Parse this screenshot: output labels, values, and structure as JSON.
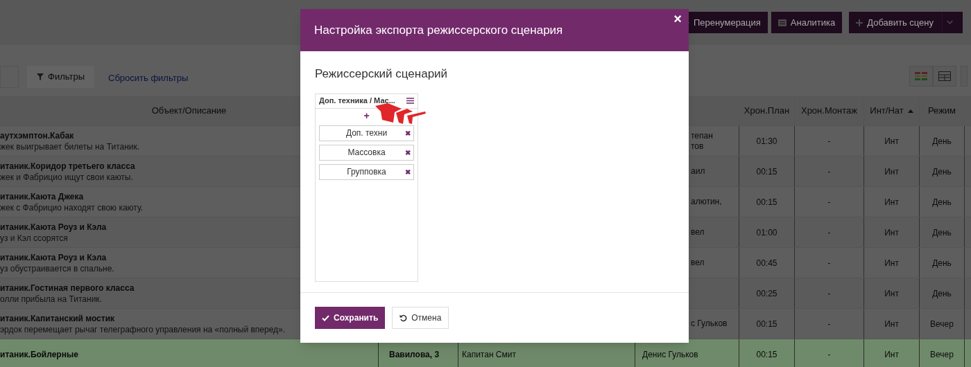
{
  "toolbar": {
    "buttons": [
      {
        "label": "Перенумерация",
        "kind": "renumber"
      },
      {
        "label": "Аналитика",
        "kind": "analytics"
      },
      {
        "label": "Добавить сцену",
        "kind": "add"
      }
    ]
  },
  "filters": {
    "button": "Фильтры",
    "reset_link": "Сбросить фильтры"
  },
  "table": {
    "columns": [
      {
        "label": "Объект/Описание",
        "sorted": false
      },
      {
        "label": "Хрон.План",
        "sorted": false
      },
      {
        "label": "Хрон.Монтаж",
        "sorted": false
      },
      {
        "label": "Инт/Нат",
        "sorted": true
      },
      {
        "label": "Режим",
        "sorted": false
      }
    ],
    "rows": [
      {
        "title": "аутхэмптон.Кабак",
        "description": "жек выигрывает билеты на Титаник.",
        "column_4": [
          "тепан",
          "тов"
        ],
        "plan": "01:30",
        "montage": "-",
        "int_nat": "Инт",
        "mode": "День",
        "highlighted": false
      },
      {
        "title": "итаник.Коридор третьего класса",
        "description": "жек и Фабрицио ищут свои каюты.",
        "column_4": [
          "аил"
        ],
        "plan": "00:15",
        "montage": "-",
        "int_nat": "Инт",
        "mode": "День",
        "highlighted": false
      },
      {
        "title": "итаник.Каюта Джека",
        "description": "жек с Фабрицио находят свою каюту.",
        "column_4": [
          "алютин,"
        ],
        "plan": "00:15",
        "montage": "-",
        "int_nat": "Инт",
        "mode": "День",
        "highlighted": false
      },
      {
        "title": "итаник.Каюта Роуз и Кэла",
        "description": "уз и Кэл ссорятся",
        "column_4": [
          "вел"
        ],
        "plan": "01:00",
        "montage": "-",
        "int_nat": "Инт",
        "mode": "День",
        "highlighted": false
      },
      {
        "title": "итаник.Каюта Роуз и Кэла",
        "description": "уз обустраивается в спальне.",
        "column_4": [
          "вел"
        ],
        "plan": "00:45",
        "montage": "-",
        "int_nat": "Инт",
        "mode": "День",
        "highlighted": false
      },
      {
        "title": "итаник.Гостиная первого класса",
        "description": "олли прибыла на Титаник.",
        "plan": "00:25",
        "montage": "-",
        "int_nat": "Инт",
        "mode": "День",
        "highlighted": false
      },
      {
        "title": "итаник.Капитанский мостик",
        "description": "эрдок перемещает рычаг телеграфного управления на «полный вперед».",
        "column_4": [
          "с Гульков"
        ],
        "plan": "00:15",
        "montage": "-",
        "int_nat": "Инт",
        "mode": "Вечер",
        "highlighted": false
      },
      {
        "title": "итаник.Бойлерные",
        "location": "Вавилова, 3",
        "character": "Капитан Смит",
        "crew": "Денис Гульков",
        "plan": "00:15",
        "montage": "-",
        "int_nat": "Инт",
        "mode": "Вечер",
        "highlighted": true
      }
    ]
  },
  "dialog": {
    "title": "Настройка экспорта режиссерского сценария",
    "close": "×",
    "section_title": "Режиссерский сценарий",
    "list": {
      "header": "Доп. техника / Мас...",
      "add": "+",
      "items": [
        {
          "label": "Доп. техни",
          "remove": "✖"
        },
        {
          "label": "Массовка",
          "remove": "✖"
        },
        {
          "label": "Групповка",
          "remove": "✖"
        }
      ]
    },
    "save": "Сохранить",
    "cancel": "Отмена"
  }
}
